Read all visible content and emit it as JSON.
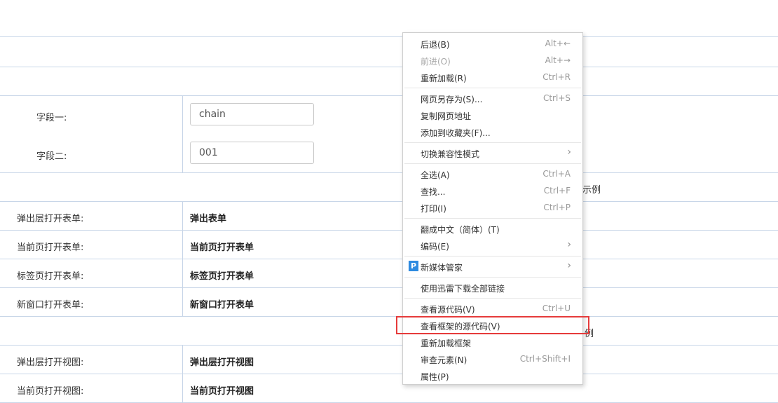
{
  "form": {
    "field1_label": "字段一:",
    "field1_value": "chain",
    "field2_label": "字段二:",
    "field2_value": "001"
  },
  "section1_partial": "示例",
  "rows1": [
    {
      "label": "弹出层打开表单:",
      "value": "弹出表单"
    },
    {
      "label": "当前页打开表单:",
      "value": "当前页打开表单"
    },
    {
      "label": "标签页打开表单:",
      "value": "标签页打开表单"
    },
    {
      "label": "新窗口打开表单:",
      "value": "新窗口打开表单"
    }
  ],
  "section2_partial": "例",
  "rows2": [
    {
      "label": "弹出层打开视图:",
      "value": "弹出层打开视图"
    },
    {
      "label": "当前页打开视图:",
      "value": "当前页打开视图"
    }
  ],
  "context_menu": {
    "back": {
      "label": "后退(B)",
      "shortcut": "Alt+←"
    },
    "forward": {
      "label": "前进(O)",
      "shortcut": "Alt+→"
    },
    "reload": {
      "label": "重新加载(R)",
      "shortcut": "Ctrl+R"
    },
    "save_as": {
      "label": "网页另存为(S)...",
      "shortcut": "Ctrl+S"
    },
    "copy_url": {
      "label": "复制网页地址"
    },
    "add_favorite": {
      "label": "添加到收藏夹(F)..."
    },
    "compat_mode": {
      "label": "切换兼容性模式"
    },
    "select_all": {
      "label": "全选(A)",
      "shortcut": "Ctrl+A"
    },
    "find": {
      "label": "查找...",
      "shortcut": "Ctrl+F"
    },
    "print": {
      "label": "打印(I)",
      "shortcut": "Ctrl+P"
    },
    "translate": {
      "label": "翻成中文（简体）(T)"
    },
    "encoding": {
      "label": "编码(E)"
    },
    "media_manager": {
      "label": "新媒体管家",
      "icon_letter": "P"
    },
    "thunder": {
      "label": "使用迅雷下载全部链接"
    },
    "view_source": {
      "label": "查看源代码(V)",
      "shortcut": "Ctrl+U"
    },
    "view_frame_source": {
      "label": "查看框架的源代码(V)"
    },
    "reload_frame": {
      "label": "重新加载框架"
    },
    "inspect": {
      "label": "审查元素(N)",
      "shortcut": "Ctrl+Shift+I"
    },
    "properties": {
      "label": "属性(P)"
    }
  },
  "colors": {
    "grid_line": "#c8d6e8",
    "highlight_border": "#e63b3b",
    "media_icon": "#2d8ae0"
  }
}
